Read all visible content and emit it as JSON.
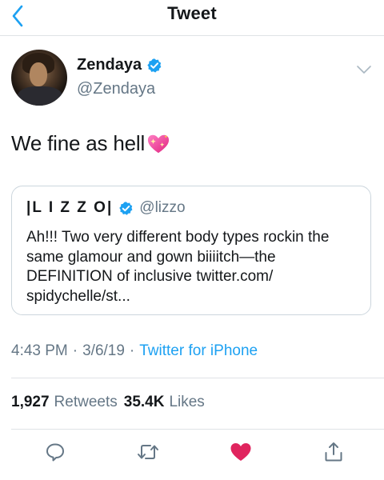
{
  "header": {
    "title": "Tweet"
  },
  "author": {
    "display_name": "Zendaya",
    "handle": "@Zendaya",
    "verified": true
  },
  "tweet": {
    "text": "We fine as hell",
    "emoji": "sparkling-heart"
  },
  "quoted_tweet": {
    "display_name": "|L I Z Z O|",
    "handle": "@lizzo",
    "verified": true,
    "body": "Ah!!! Two very different body types rockin the same glamour and gown biiiitch—the DEFINITION of inclusive twitter.com/ spidychelle/st..."
  },
  "meta": {
    "time": "4:43 PM",
    "separator": "·",
    "date": "3/6/19",
    "source": "Twitter for iPhone"
  },
  "stats": {
    "retweets_count": "1,927",
    "retweets_label": "Retweets",
    "likes_count": "35.4K",
    "likes_label": "Likes"
  },
  "actions": {
    "reply": "reply-icon",
    "retweet": "retweet-icon",
    "like": "heart-icon",
    "share": "share-icon",
    "like_color": "#e0245e",
    "icon_color": "#657786"
  },
  "colors": {
    "accent": "#1da1f2",
    "secondary_text": "#657786",
    "primary_text": "#14171a"
  }
}
